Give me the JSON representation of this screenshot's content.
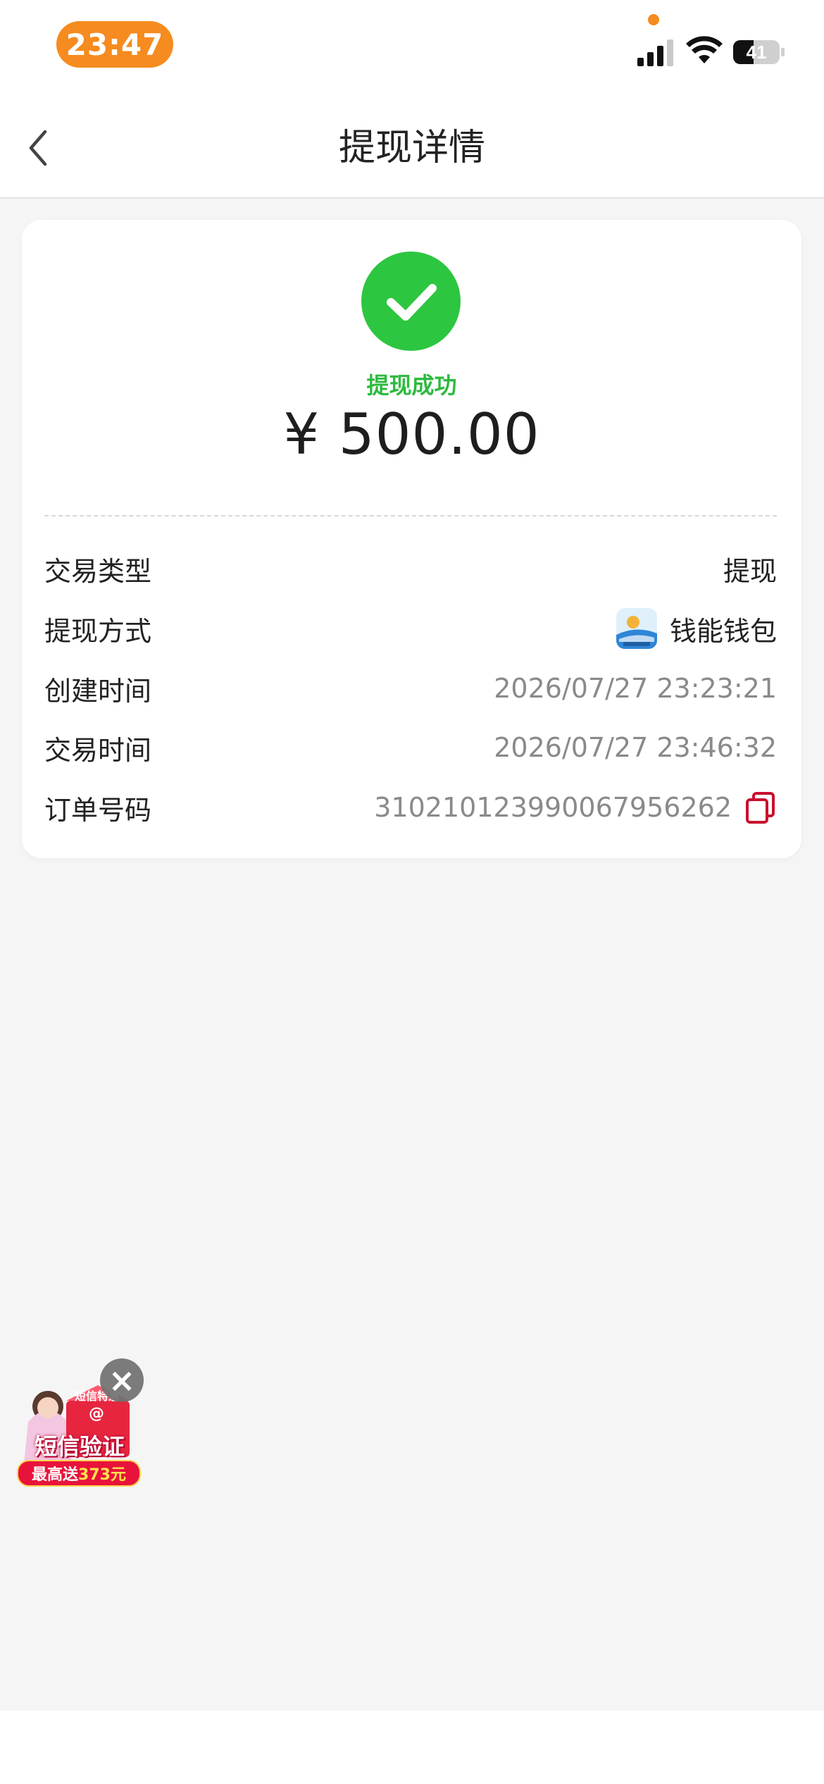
{
  "status_bar": {
    "time": "23:47",
    "battery": "41"
  },
  "nav": {
    "title": "提现详情"
  },
  "result": {
    "status": "提现成功",
    "amount": "¥ 500.00"
  },
  "details": [
    {
      "label": "交易类型",
      "value": "提现"
    },
    {
      "label": "提现方式",
      "value": "钱能钱包"
    },
    {
      "label": "创建时间",
      "value": "2026/07/27 23:23:21"
    },
    {
      "label": "交易时间",
      "value": "2026/07/27 23:46:32"
    },
    {
      "label": "订单号码",
      "value": "310210123990067956262"
    }
  ],
  "ad": {
    "tag": "短信特惠",
    "main": "短信验证",
    "sub_prefix": "最高送",
    "sub_amount": "373元"
  },
  "colors": {
    "accent": "#f68b1f",
    "success": "#2dc640",
    "copy_icon": "#c8102e"
  },
  "icons": [
    "back-chevron-icon",
    "check-icon",
    "wallet-app-icon",
    "copy-icon",
    "close-icon"
  ]
}
